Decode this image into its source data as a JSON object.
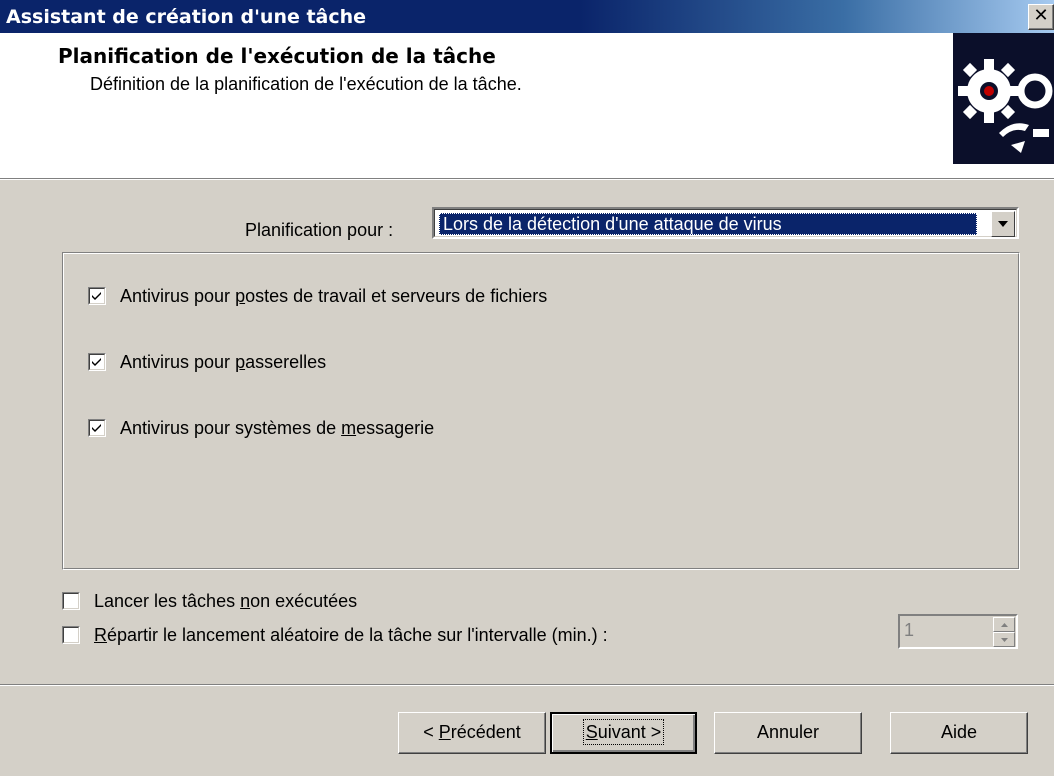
{
  "window": {
    "title": "Assistant de création d'une tâche",
    "close_glyph": "✕"
  },
  "header": {
    "title": "Planification de l'exécution de la tâche",
    "subtitle": "Définition de la planification de l'exécution de la tâche.",
    "icon": "gears-icon"
  },
  "schedule": {
    "label": "Planification pour :",
    "selected": "Lors de la détection d'une attaque de virus"
  },
  "group": {
    "options": [
      {
        "pre": "Antivirus pour ",
        "u": "p",
        "post": "ostes de travail et serveurs de fichiers",
        "checked": true
      },
      {
        "pre": "Antivirus pour ",
        "u": "p",
        "post": "asserelles",
        "checked": true
      },
      {
        "pre": "Antivirus pour systèmes de ",
        "u": "m",
        "post": "essagerie",
        "checked": true
      }
    ]
  },
  "launch_missed": {
    "pre": "Lancer les tâches ",
    "u": "n",
    "post": "on exécutées",
    "checked": false
  },
  "randomize": {
    "pre": "",
    "u": "R",
    "post": "épartir le lancement aléatoire de la tâche sur l'intervalle (min.) :",
    "checked": false,
    "value": "1"
  },
  "buttons": {
    "back": {
      "pre": "< ",
      "u": "P",
      "post": "récédent"
    },
    "next": {
      "pre": "",
      "u": "S",
      "post": "uivant >"
    },
    "cancel": "Annuler",
    "help": "Aide"
  }
}
